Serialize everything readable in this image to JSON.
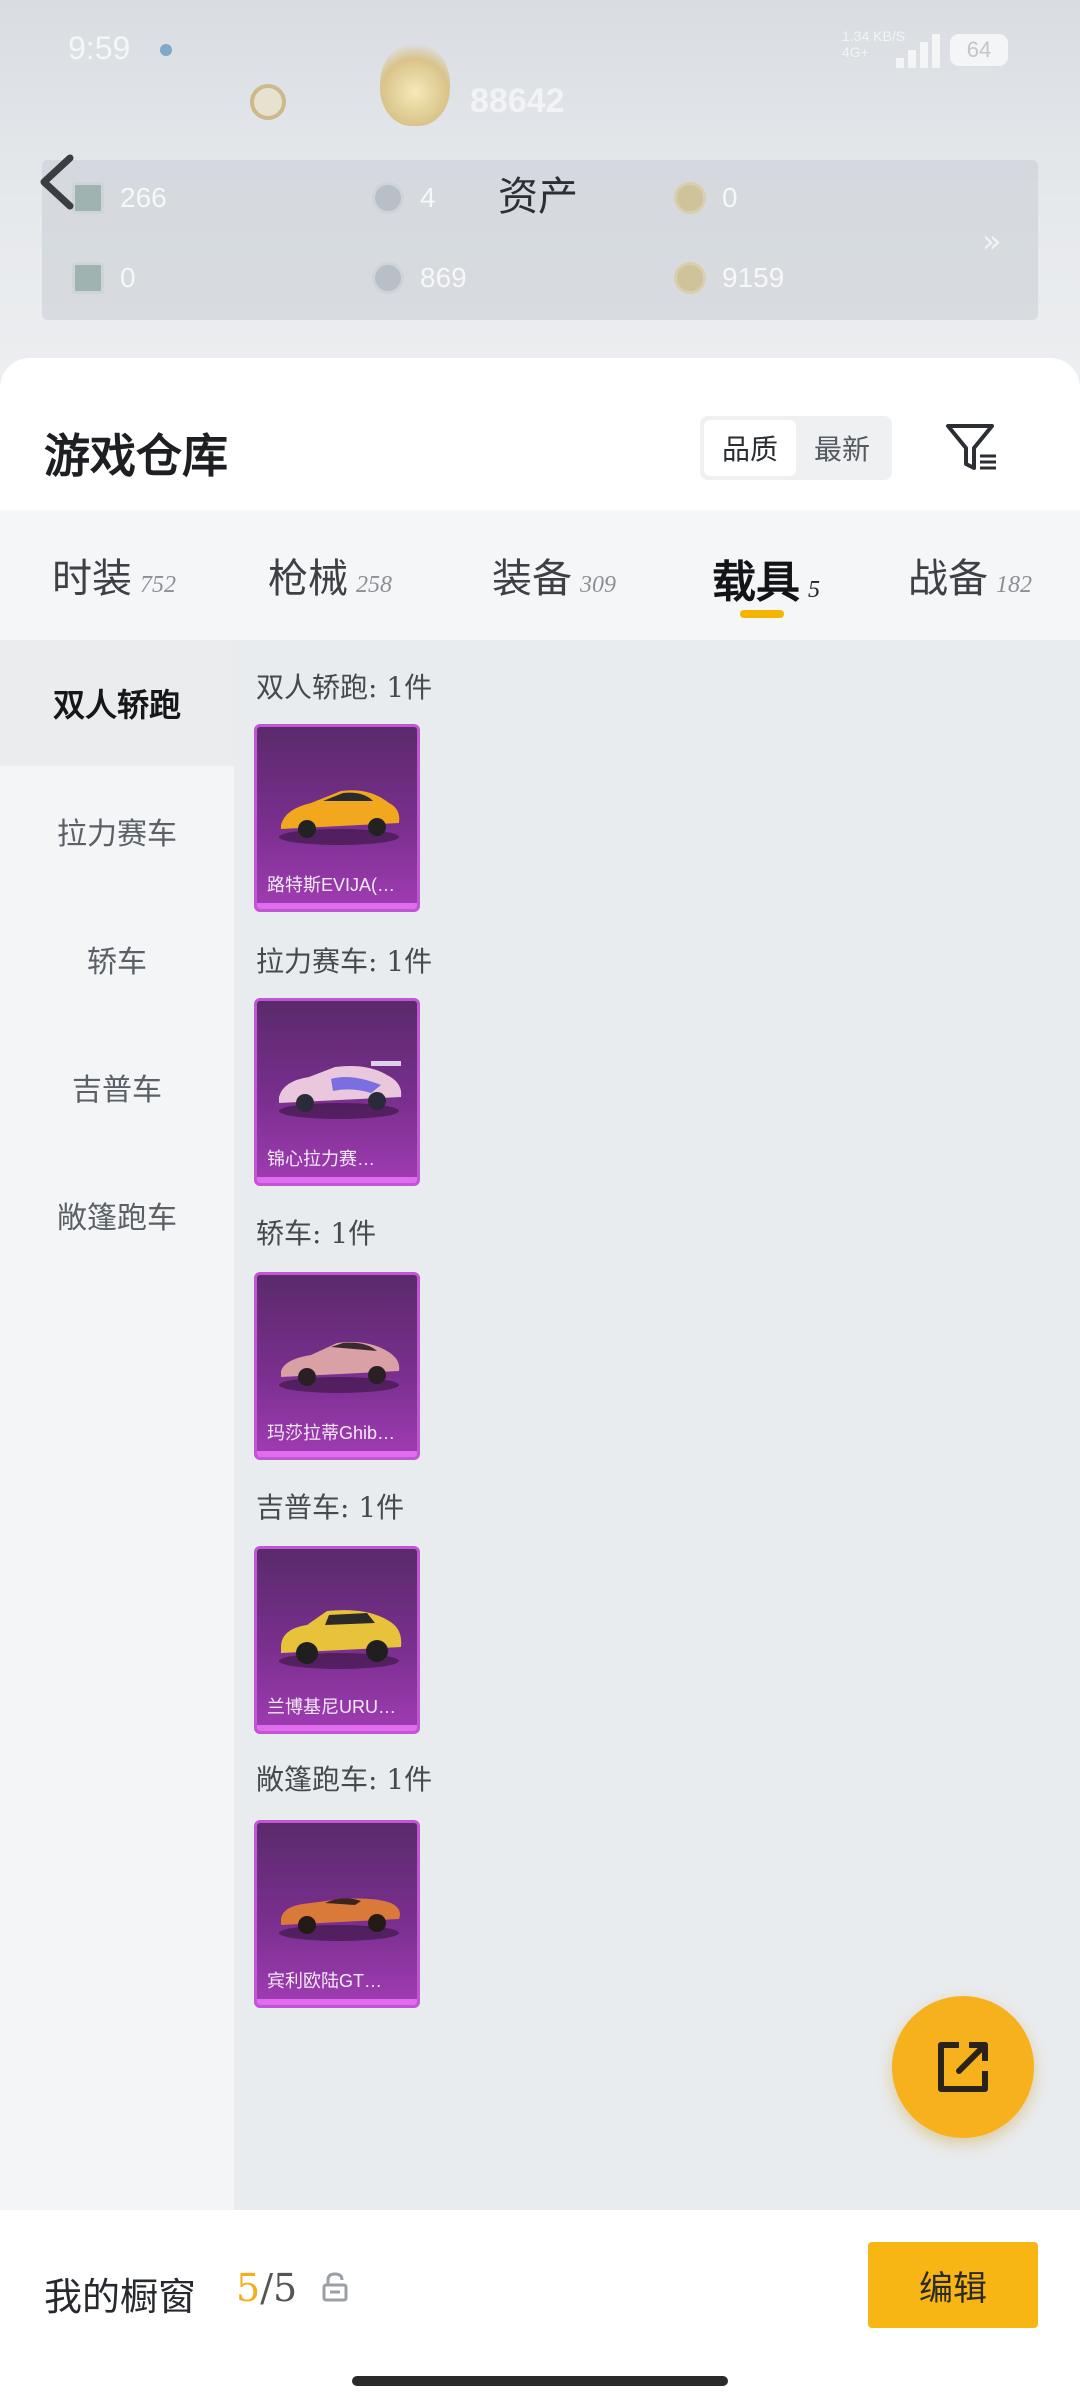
{
  "status_bar": {
    "time": "9:59",
    "net_top": "1.34 KB/S",
    "net_bottom": "4G+",
    "battery": "64"
  },
  "header": {
    "score": "88642",
    "title": "资产"
  },
  "assets": [
    {
      "value": "266",
      "icon": "ticket-icon"
    },
    {
      "value": "4",
      "icon": "silver-coin-icon"
    },
    {
      "value": "0",
      "icon": "gold-coin-icon"
    },
    {
      "value": "0",
      "icon": "card-icon"
    },
    {
      "value": "869",
      "icon": "silver-token-icon"
    },
    {
      "value": "9159",
      "icon": "gold-token-icon"
    }
  ],
  "warehouse": {
    "title": "游戏仓库",
    "sort_options": [
      "品质",
      "最新"
    ],
    "sort_active": 0
  },
  "tabs": [
    {
      "label": "时装",
      "count": "752"
    },
    {
      "label": "枪械",
      "count": "258"
    },
    {
      "label": "装备",
      "count": "309"
    },
    {
      "label": "载具",
      "count": "5"
    },
    {
      "label": "战备",
      "count": "182"
    }
  ],
  "sidebar": [
    "双人轿跑",
    "拉力赛车",
    "轿车",
    "吉普车",
    "敞篷跑车"
  ],
  "groups": [
    {
      "label": "双人轿跑: 1件",
      "card_name": "路特斯EVIJA(…",
      "car_color": "#f2a81e"
    },
    {
      "label": "拉力赛车: 1件",
      "card_name": "锦心拉力赛…",
      "car_color": "#e9c7dc"
    },
    {
      "label": "轿车: 1件",
      "card_name": "玛莎拉蒂Ghib…",
      "car_color": "#d9a1a6"
    },
    {
      "label": "吉普车: 1件",
      "card_name": "兰博基尼URU…",
      "car_color": "#e9c23c"
    },
    {
      "label": "敞篷跑车: 1件",
      "card_name": "宾利欧陆GT…",
      "car_color": "#d97a3a"
    }
  ],
  "bottom": {
    "title": "我的橱窗",
    "current": "5",
    "total": "/5",
    "edit_label": "编辑"
  }
}
